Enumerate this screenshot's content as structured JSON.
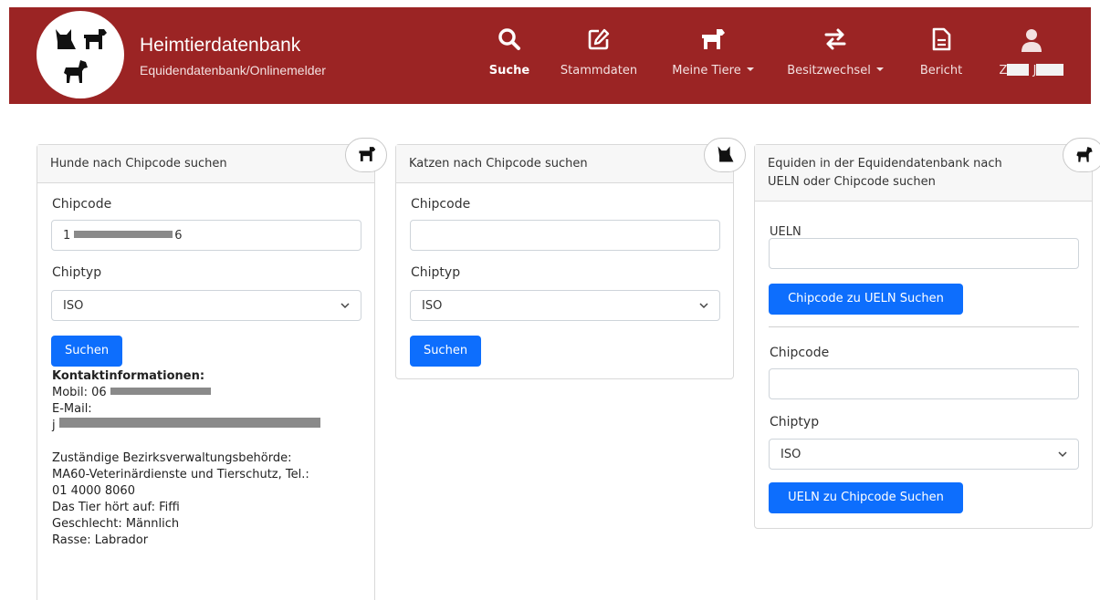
{
  "header": {
    "title": "Heimtierdatenbank",
    "subtitle": "Equidendatenbank/Onlinemelder",
    "background": "#9b2424",
    "nav": [
      {
        "label": "Suche",
        "icon": "search-icon",
        "active": true
      },
      {
        "label": "Stammdaten",
        "icon": "edit-icon"
      },
      {
        "label": "Meine Tiere",
        "icon": "dog-icon",
        "dropdown": true
      },
      {
        "label": "Besitzwechsel",
        "icon": "exchange-icon",
        "dropdown": true
      },
      {
        "label": "Bericht",
        "icon": "document-icon"
      }
    ],
    "user": {
      "initial_first": "Z",
      "initial_last": "J",
      "icon": "user-icon"
    }
  },
  "dog_card": {
    "title": "Hunde nach Chipcode suchen",
    "chipcode_label": "Chipcode",
    "chipcode_value_start": "1",
    "chipcode_value_end": "6",
    "chiptyp_label": "Chiptyp",
    "chiptyp_value": "ISO",
    "search_button": "Suchen",
    "contact_heading": "Kontaktinformationen:",
    "mobile_label": "Mobil: 06",
    "email_label": "E-Mail:",
    "email_start": "j",
    "authority_line1": "Zuständige Bezirksverwaltungsbehörde:",
    "authority_line2": "MA60-Veterinärdienste und Tierschutz, Tel.:",
    "authority_line3": "01 4000 8060",
    "name_line": "Das Tier hört auf: Fiffi",
    "sex_line": "Geschlecht: Männlich",
    "breed_line": "Rasse: Labrador"
  },
  "cat_card": {
    "title": "Katzen nach Chipcode suchen",
    "chipcode_label": "Chipcode",
    "chipcode_value": "",
    "chiptyp_label": "Chiptyp",
    "chiptyp_value": "ISO",
    "search_button": "Suchen"
  },
  "equid_card": {
    "title_line1": "Equiden in der Equidendatenbank nach",
    "title_line2": "UELN oder Chipcode suchen",
    "ueln_label": "UELN",
    "ueln_value": "",
    "ueln_button": "Chipcode zu UELN Suchen",
    "chipcode_label": "Chipcode",
    "chipcode_value": "",
    "chiptyp_label": "Chiptyp",
    "chiptyp_value": "ISO",
    "chip_button": "UELN zu Chipcode Suchen"
  }
}
